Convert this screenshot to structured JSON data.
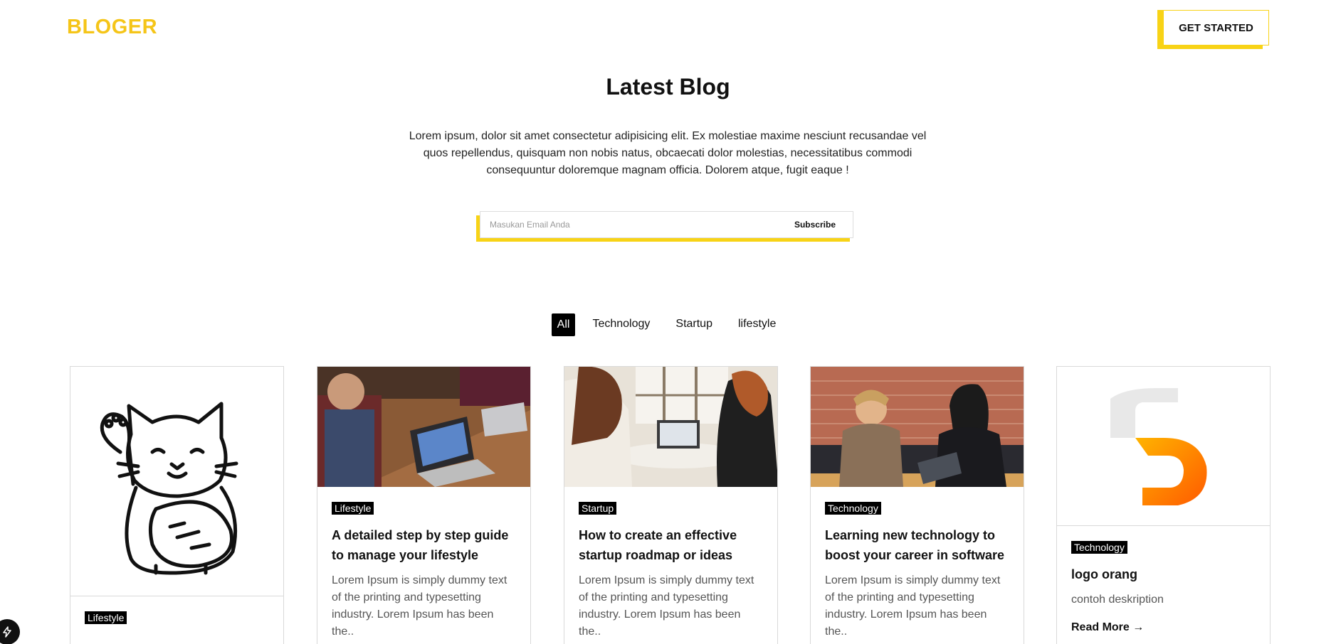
{
  "header": {
    "logo": "BLOGER",
    "cta_label": "GET STARTED"
  },
  "hero": {
    "title": "Latest Blog",
    "description": "Lorem ipsum, dolor sit amet consectetur adipisicing elit. Ex molestiae maxime nesciunt recusandae vel quos repellendus, quisquam non nobis natus, obcaecati dolor molestias, necessitatibus commodi consequuntur doloremque magnam officia. Dolorem atque, fugit eaque !"
  },
  "subscribe": {
    "placeholder": "Masukan Email Anda",
    "button_label": "Subscribe"
  },
  "filters": [
    {
      "label": "All",
      "active": true
    },
    {
      "label": "Technology",
      "active": false
    },
    {
      "label": "Startup",
      "active": false
    },
    {
      "label": "lifestyle",
      "active": false
    }
  ],
  "cards": [
    {
      "image": "lucky-cat-illustration",
      "category": "Lifestyle",
      "title": "",
      "excerpt": ""
    },
    {
      "image": "people-laptops-meeting-photo",
      "category": "Lifestyle",
      "title": "A detailed step by step guide to manage your lifestyle",
      "excerpt": "Lorem Ipsum is simply dummy text of the printing and typesetting industry. Lorem Ipsum has been the.."
    },
    {
      "image": "women-laptop-photo",
      "category": "Startup",
      "title": "How to create an effective startup roadmap or ideas",
      "excerpt": "Lorem Ipsum is simply dummy text of the printing and typesetting industry. Lorem Ipsum has been the.."
    },
    {
      "image": "women-tablet-meeting-photo",
      "category": "Technology",
      "title": "Learning new technology to boost your career in software",
      "excerpt": "Lorem Ipsum is simply dummy text of the printing and typesetting industry. Lorem Ipsum has been the.."
    },
    {
      "image": "orange-s-logo",
      "category": "Technology",
      "title": "logo orang",
      "excerpt": "contoh deskription",
      "read_more": "Read More"
    }
  ],
  "colors": {
    "accent": "#f8d316",
    "logo": "#f5c518",
    "text": "#111111"
  }
}
